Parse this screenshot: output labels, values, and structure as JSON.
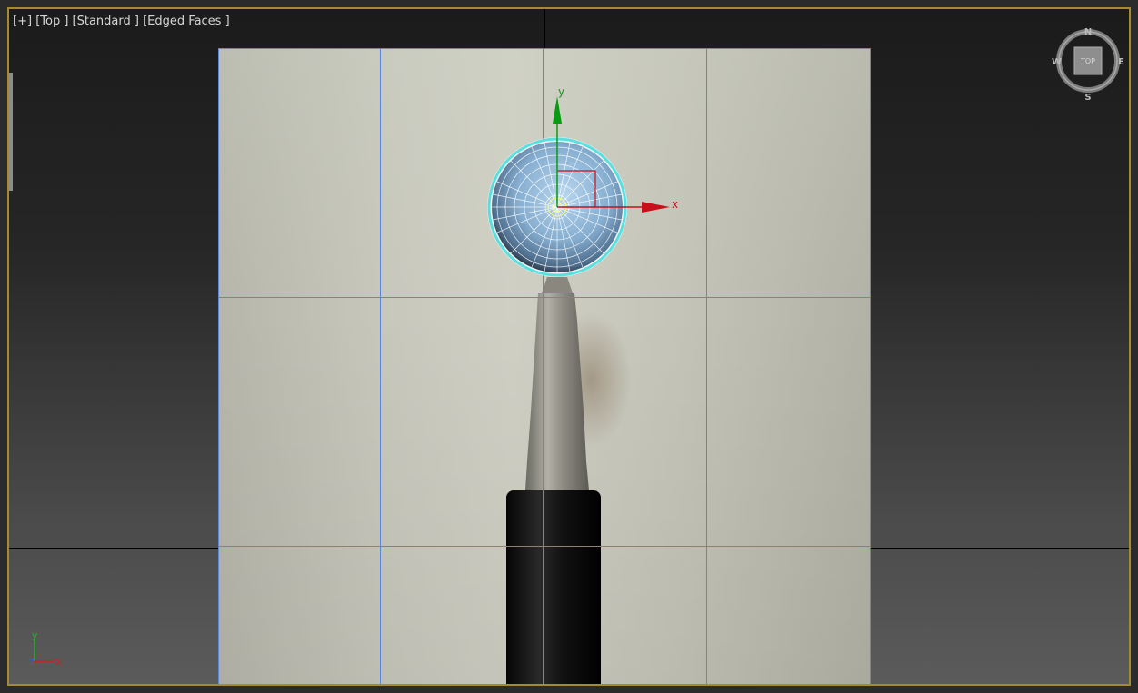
{
  "viewport": {
    "label_parts": [
      "[+]",
      "[Top ]",
      "[Standard ]",
      "[Edged Faces ]"
    ],
    "active_border_color": "#a58a2e"
  },
  "gizmo": {
    "x_label": "x",
    "y_label": "y",
    "x_color": "#c8101a",
    "y_color": "#0a9a12"
  },
  "viewcube": {
    "face": "TOP",
    "north": "N",
    "south": "S",
    "east": "E",
    "west": "W"
  },
  "world_axis_indicator": {
    "x": "x",
    "y": "y",
    "z": "z"
  },
  "colors": {
    "grid": "#5d86d8",
    "selection": "#58e0e0",
    "sphere": "#8fb7d8"
  }
}
